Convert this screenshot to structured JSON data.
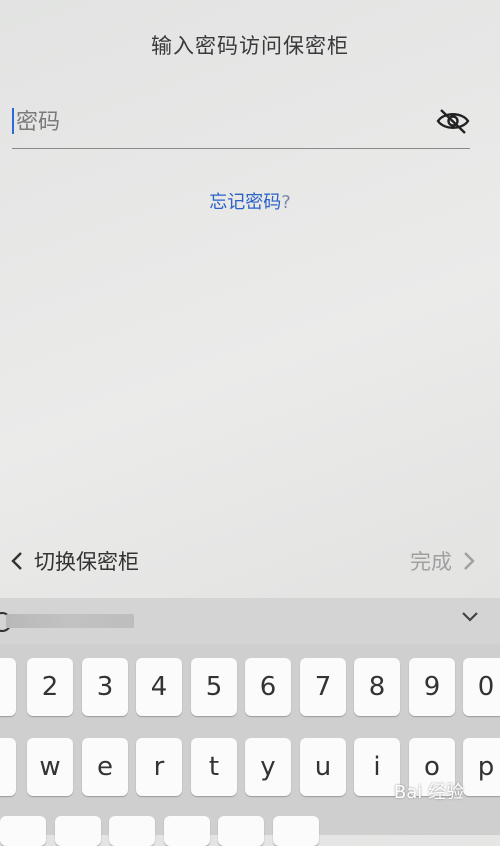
{
  "header": {
    "title": "输入密码访问保密柜"
  },
  "password": {
    "placeholder": "密码"
  },
  "forgot": {
    "link_text": "忘记密码",
    "suffix": "?"
  },
  "bottom_bar": {
    "back_label": "切换保密柜",
    "done_label": "完成"
  },
  "keyboard": {
    "number_row": [
      "2",
      "3",
      "4",
      "5",
      "6",
      "7",
      "8",
      "9",
      "0"
    ],
    "letter_row": [
      "w",
      "e",
      "r",
      "t",
      "y",
      "u",
      "i",
      "o",
      "p"
    ]
  },
  "watermark": "Bai 经验",
  "colors": {
    "link": "#2a62c8",
    "caret": "#2a6ad8",
    "keyboard_bg": "#cfcfcf"
  }
}
